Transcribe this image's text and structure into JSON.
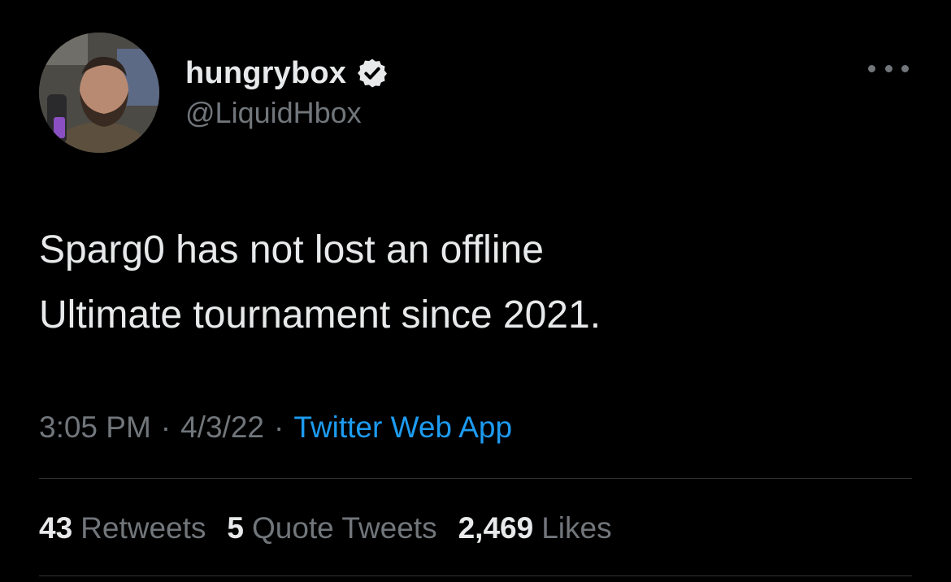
{
  "author": {
    "display_name": "hungrybox",
    "handle": "@LiquidHbox",
    "verified": true,
    "avatar_icon": "profile-photo"
  },
  "tweet": {
    "text_lines": [
      "Sparg0 has not lost an offline",
      "Ultimate tournament since 2021."
    ],
    "time": "3:05 PM",
    "date": "4/3/22",
    "separator": "·",
    "source": "Twitter Web App"
  },
  "stats": {
    "retweets_count": "43",
    "retweets_label": "Retweets",
    "quotes_count": "5",
    "quotes_label": "Quote Tweets",
    "likes_count": "2,469",
    "likes_label": "Likes"
  },
  "colors": {
    "background": "#000000",
    "primary_text": "#e7e9ea",
    "secondary_text": "#71767b",
    "accent": "#1d9bf0",
    "divider": "#2f3336"
  }
}
